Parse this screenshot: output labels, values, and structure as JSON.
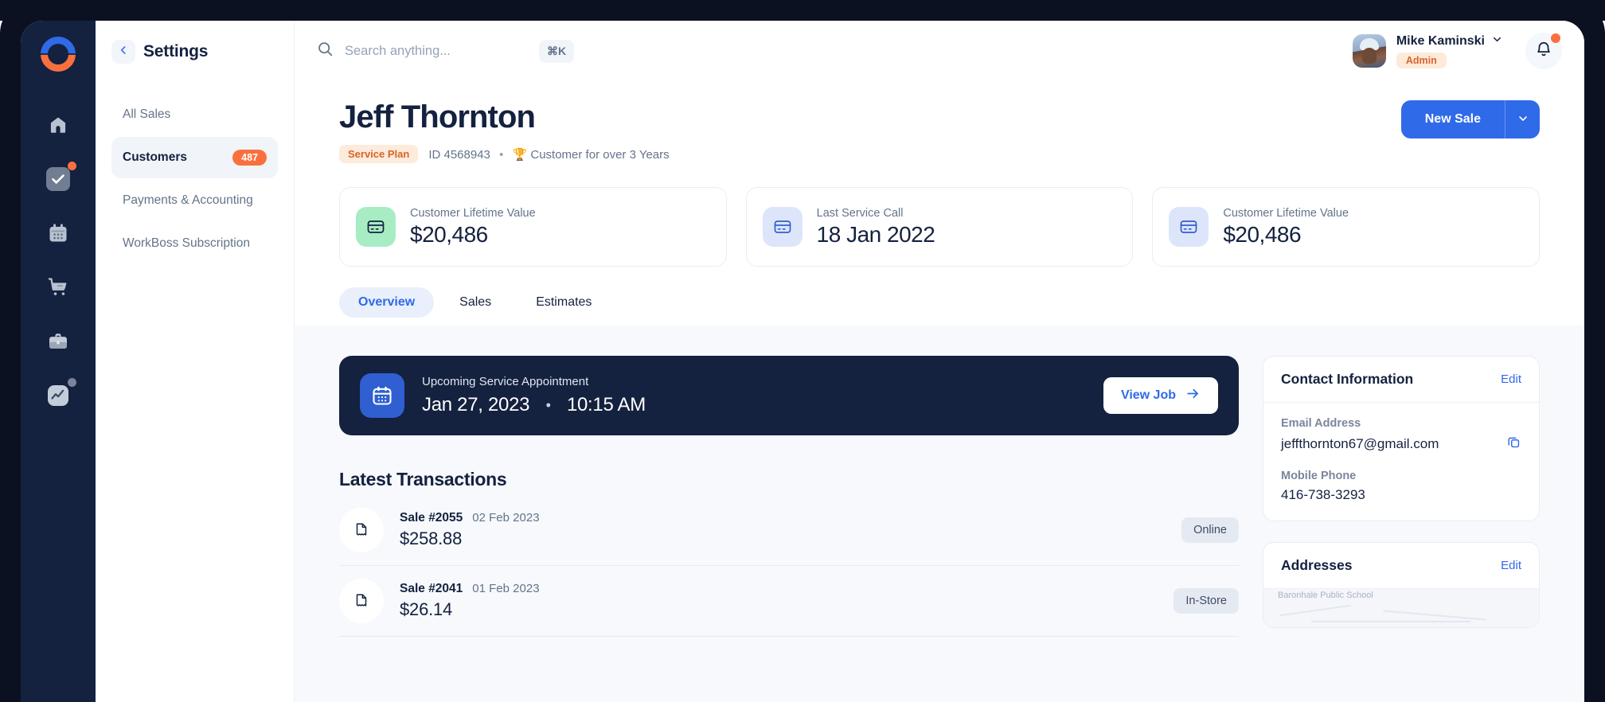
{
  "rail": {
    "logo_name": "workboss-logo",
    "items": [
      {
        "icon": "home-icon",
        "badge": null
      },
      {
        "icon": "tasks-check-icon",
        "badge": "orange-dot"
      },
      {
        "icon": "calendar-icon",
        "badge": null
      },
      {
        "icon": "shopping-cart-icon",
        "badge": null
      },
      {
        "icon": "briefcase-icon",
        "badge": null
      },
      {
        "icon": "analytics-icon",
        "badge": "gray-dot"
      }
    ]
  },
  "settings": {
    "title": "Settings",
    "back_icon": "chevron-left-icon",
    "items": [
      {
        "label": "All Sales",
        "badge": "",
        "active": false
      },
      {
        "label": "Customers",
        "badge": "487",
        "active": true
      },
      {
        "label": "Payments & Accounting",
        "badge": "",
        "active": false
      },
      {
        "label": "WorkBoss Subscription",
        "badge": "",
        "active": false
      }
    ]
  },
  "topbar": {
    "search_placeholder": "Search anything...",
    "search_value": "",
    "shortcut": "⌘K",
    "user_name": "Mike Kaminski",
    "user_role": "Admin"
  },
  "customer": {
    "name": "Jeff Thornton",
    "plan_badge": "Service Plan",
    "id_text": "ID 4568943",
    "separator": "•",
    "tenure_icon": "🏆",
    "tenure_text": "Customer for over 3 Years",
    "primary_button": "New Sale"
  },
  "stats": [
    {
      "label": "Customer Lifetime Value",
      "value": "$20,486",
      "icon": "credit-card-icon",
      "tone": "green"
    },
    {
      "label": "Last Service Call",
      "value": "18 Jan 2022",
      "icon": "credit-card-icon",
      "tone": "blue"
    },
    {
      "label": "Customer Lifetime Value",
      "value": "$20,486",
      "icon": "credit-card-icon",
      "tone": "blue"
    }
  ],
  "tabs": [
    {
      "label": "Overview",
      "active": true
    },
    {
      "label": "Sales",
      "active": false
    },
    {
      "label": "Estimates",
      "active": false
    }
  ],
  "appointment": {
    "label": "Upcoming Service Appointment",
    "date": "Jan 27, 2023",
    "separator": "•",
    "time": "10:15 AM",
    "button": "View Job",
    "icon": "calendar-icon"
  },
  "transactions": {
    "title": "Latest Transactions",
    "rows": [
      {
        "id": "Sale #2055",
        "date": "02 Feb 2023",
        "amount": "$258.88",
        "channel": "Online"
      },
      {
        "id": "Sale #2041",
        "date": "01 Feb 2023",
        "amount": "$26.14",
        "channel": "In-Store"
      }
    ]
  },
  "contact_card": {
    "title": "Contact Information",
    "edit": "Edit",
    "email_label": "Email Address",
    "email_value": "jeffthornton67@gmail.com",
    "phone_label": "Mobile Phone",
    "phone_value": "416-738-3293"
  },
  "addresses_card": {
    "title": "Addresses",
    "edit": "Edit",
    "map_label": "Baronhale Public School"
  },
  "colors": {
    "brand_blue": "#2f6ae8",
    "brand_orange": "#f9703e",
    "navy": "#14213f",
    "page_bg": "#f7f9fc",
    "green_tint": "#a8ecc4"
  }
}
